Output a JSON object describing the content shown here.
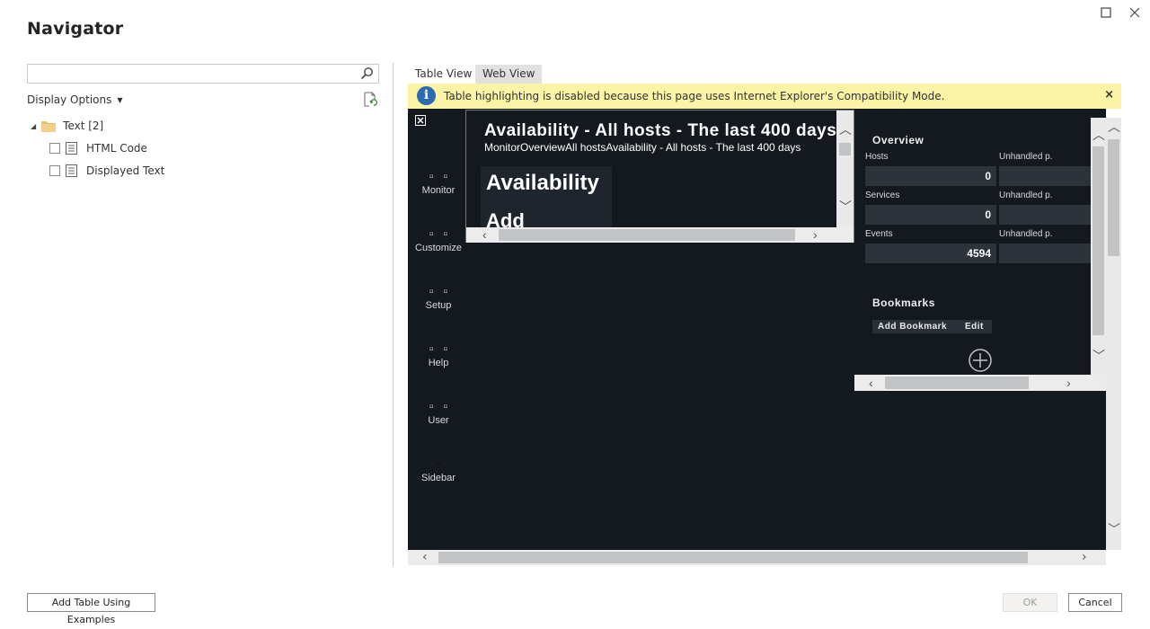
{
  "window": {
    "title": "Navigator",
    "maximize_icon": "maximize-icon",
    "close_icon": "close-icon"
  },
  "left": {
    "search": {
      "value": "",
      "placeholder": ""
    },
    "display_options_label": "Display Options",
    "tree": {
      "folder_label": "Text [2]",
      "items": [
        {
          "label": "HTML Code",
          "checked": false
        },
        {
          "label": "Displayed Text",
          "checked": false
        }
      ]
    },
    "add_table_button": "Add Table Using Examples"
  },
  "right": {
    "tabs": [
      {
        "label": "Table View",
        "active": false
      },
      {
        "label": "Web View",
        "active": true
      }
    ],
    "info_message": "Table highlighting is disabled because this page uses Internet Explorer's Compatibility Mode.",
    "info_close": "×",
    "web": {
      "close_glyph": "✕",
      "nav": [
        {
          "label": "Monitor"
        },
        {
          "label": "Customize"
        },
        {
          "label": "Setup"
        },
        {
          "label": "Help"
        },
        {
          "label": "User"
        },
        {
          "label": "Sidebar"
        }
      ],
      "main": {
        "title": "Availability - All hosts - The last 400 days",
        "breadcrumb": "MonitorOverviewAll hostsAvailability - All hosts - The last 400 days",
        "heading1": "Availability",
        "heading2": "Add"
      },
      "overview": {
        "title": "Overview",
        "stats": [
          {
            "label": "Hosts",
            "value": "0",
            "label2": "Unhandled p."
          },
          {
            "label": "Services",
            "value": "0",
            "label2": "Unhandled p."
          },
          {
            "label": "Events",
            "value": "4594",
            "label2": "Unhandled p."
          }
        ],
        "bookmarks_title": "Bookmarks",
        "add_bookmark": "Add Bookmark",
        "edit": "Edit"
      }
    }
  },
  "footer": {
    "ok": "OK",
    "cancel": "Cancel"
  }
}
